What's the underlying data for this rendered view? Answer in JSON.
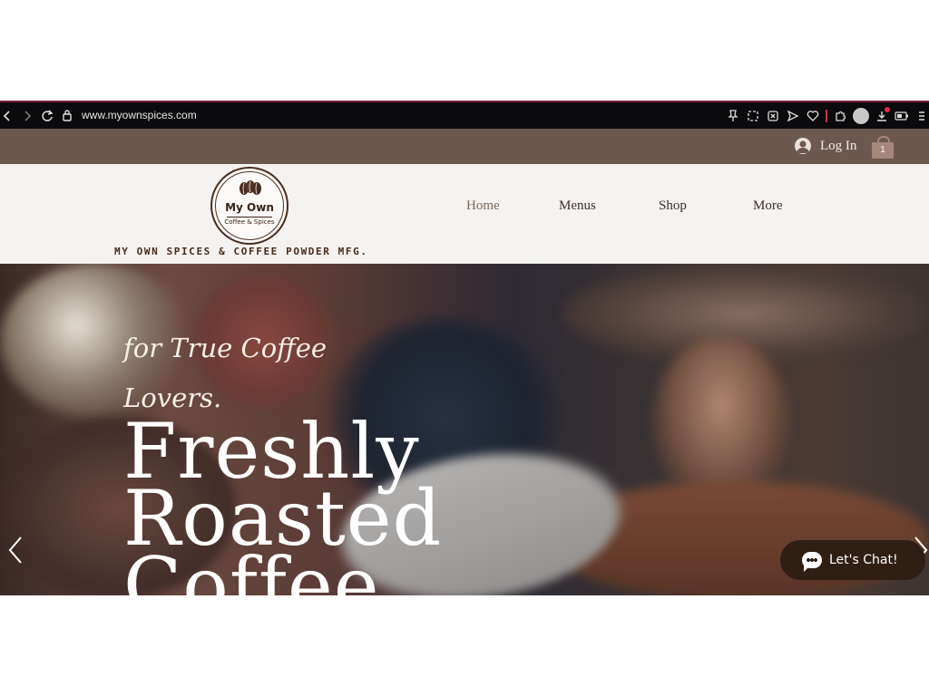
{
  "browser": {
    "url": "www.myownspices.com"
  },
  "topbar": {
    "login_label": "Log In",
    "cart_count": "1"
  },
  "header": {
    "logo_title": "My Own",
    "logo_subtitle": "Coffee & Spices",
    "tagline": "MY OWN SPICES & COFFEE POWDER MFG.",
    "nav": [
      {
        "label": "Home",
        "active": true
      },
      {
        "label": "Menus",
        "active": false
      },
      {
        "label": "Shop",
        "active": false
      },
      {
        "label": "More",
        "active": false
      }
    ]
  },
  "hero": {
    "subtitle": "for True Coffee Lovers.",
    "title_lines": [
      "Freshly",
      "Roasted",
      "Coffee"
    ]
  },
  "chat": {
    "label": "Let's Chat!"
  },
  "colors": {
    "topbar": "#6b584f",
    "chat_bg": "#2f1e14",
    "cart": "#a4877a",
    "nav_text": "#3c2e28"
  }
}
